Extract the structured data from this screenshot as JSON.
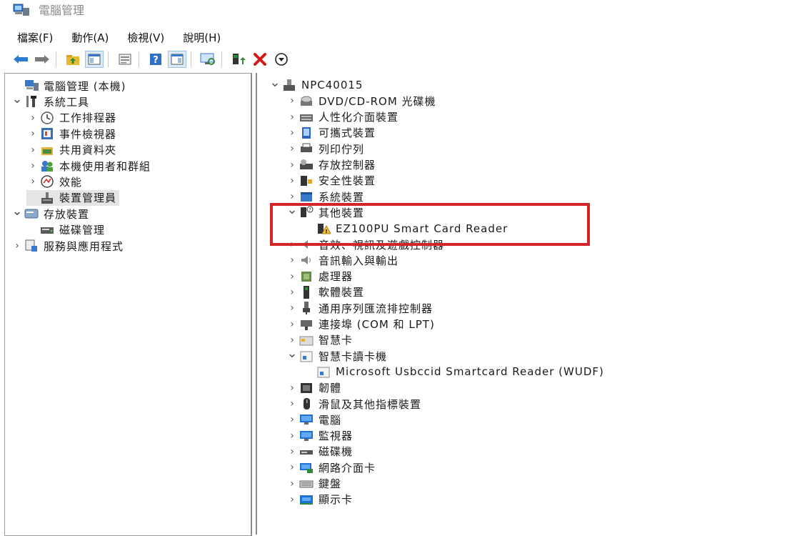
{
  "window": {
    "title": "電腦管理"
  },
  "menubar": {
    "items": [
      "檔案(F)",
      "動作(A)",
      "檢視(V)",
      "說明(H)"
    ]
  },
  "toolbar": {
    "buttons": [
      {
        "icon": "back-arrow-icon"
      },
      {
        "icon": "forward-arrow-icon"
      },
      {
        "icon": "folder-up-icon"
      },
      {
        "icon": "show-hide-tree-icon"
      },
      {
        "icon": "properties-icon"
      },
      {
        "icon": "help-icon"
      },
      {
        "icon": "console-view-icon"
      },
      {
        "icon": "monitor-scan-icon"
      },
      {
        "icon": "update-driver-icon"
      },
      {
        "icon": "uninstall-x-icon"
      },
      {
        "icon": "download-arrow-icon"
      }
    ]
  },
  "left_tree": [
    {
      "label": "電腦管理 (本機)",
      "icon": "computer-management-icon",
      "chev": "",
      "indent": 0
    },
    {
      "label": "系統工具",
      "icon": "system-tools-icon",
      "chev": "expanded",
      "indent": 0
    },
    {
      "label": "工作排程器",
      "icon": "task-scheduler-icon",
      "chev": "collapsed",
      "indent": 1
    },
    {
      "label": "事件檢視器",
      "icon": "event-viewer-icon",
      "chev": "collapsed",
      "indent": 1
    },
    {
      "label": "共用資料夾",
      "icon": "shared-folders-icon",
      "chev": "collapsed",
      "indent": 1
    },
    {
      "label": "本機使用者和群組",
      "icon": "local-users-icon",
      "chev": "collapsed",
      "indent": 1
    },
    {
      "label": "效能",
      "icon": "performance-icon",
      "chev": "collapsed",
      "indent": 1
    },
    {
      "label": "裝置管理員",
      "icon": "device-manager-icon",
      "chev": "",
      "indent": 1,
      "selected": true
    },
    {
      "label": "存放裝置",
      "icon": "storage-icon",
      "chev": "expanded",
      "indent": 0
    },
    {
      "label": "磁碟管理",
      "icon": "disk-management-icon",
      "chev": "",
      "indent": 1
    },
    {
      "label": "服務與應用程式",
      "icon": "services-apps-icon",
      "chev": "collapsed",
      "indent": 0
    }
  ],
  "right_tree": [
    {
      "label": "NPC40015",
      "icon": "computer-root-icon",
      "chev": "expanded",
      "indent": 0
    },
    {
      "label": "DVD/CD-ROM 光碟機",
      "icon": "dvd-drive-icon",
      "chev": "collapsed",
      "indent": 1
    },
    {
      "label": "人性化介面裝置",
      "icon": "hid-icon",
      "chev": "collapsed",
      "indent": 1
    },
    {
      "label": "可攜式裝置",
      "icon": "portable-device-icon",
      "chev": "collapsed",
      "indent": 1
    },
    {
      "label": "列印佇列",
      "icon": "print-queue-icon",
      "chev": "collapsed",
      "indent": 1
    },
    {
      "label": "存放控制器",
      "icon": "storage-controller-icon",
      "chev": "collapsed",
      "indent": 1
    },
    {
      "label": "安全性裝置",
      "icon": "security-device-icon",
      "chev": "collapsed",
      "indent": 1
    },
    {
      "label": "系統裝置",
      "icon": "system-device-icon",
      "chev": "collapsed",
      "indent": 1
    },
    {
      "label": "其他裝置",
      "icon": "other-devices-icon",
      "chev": "expanded",
      "indent": 1
    },
    {
      "label": "EZ100PU Smart Card Reader",
      "icon": "warning-device-icon",
      "chev": "",
      "indent": 2
    },
    {
      "label": "音效、視訊及遊戲控制器",
      "icon": "sound-video-icon",
      "chev": "collapsed",
      "indent": 1
    },
    {
      "label": "音訊輸入與輸出",
      "icon": "audio-io-icon",
      "chev": "collapsed",
      "indent": 1
    },
    {
      "label": "處理器",
      "icon": "processor-icon",
      "chev": "collapsed",
      "indent": 1
    },
    {
      "label": "軟體裝置",
      "icon": "software-device-icon",
      "chev": "collapsed",
      "indent": 1
    },
    {
      "label": "通用序列匯流排控制器",
      "icon": "usb-controller-icon",
      "chev": "collapsed",
      "indent": 1
    },
    {
      "label": "連接埠 (COM 和 LPT)",
      "icon": "ports-icon",
      "chev": "collapsed",
      "indent": 1
    },
    {
      "label": "智慧卡",
      "icon": "smart-card-icon",
      "chev": "collapsed",
      "indent": 1
    },
    {
      "label": "智慧卡讀卡機",
      "icon": "smart-card-reader-icon",
      "chev": "expanded",
      "indent": 1
    },
    {
      "label": "Microsoft Usbccid Smartcard Reader (WUDF)",
      "icon": "smart-card-reader-device-icon",
      "chev": "",
      "indent": 2
    },
    {
      "label": "韌體",
      "icon": "firmware-icon",
      "chev": "collapsed",
      "indent": 1
    },
    {
      "label": "滑鼠及其他指標裝置",
      "icon": "mouse-icon",
      "chev": "collapsed",
      "indent": 1
    },
    {
      "label": "電腦",
      "icon": "computer-icon",
      "chev": "collapsed",
      "indent": 1
    },
    {
      "label": "監視器",
      "icon": "monitor-icon",
      "chev": "collapsed",
      "indent": 1
    },
    {
      "label": "磁碟機",
      "icon": "disk-drive-icon",
      "chev": "collapsed",
      "indent": 1
    },
    {
      "label": "網路介面卡",
      "icon": "network-adapter-icon",
      "chev": "collapsed",
      "indent": 1
    },
    {
      "label": "鍵盤",
      "icon": "keyboard-icon",
      "chev": "collapsed",
      "indent": 1
    },
    {
      "label": "顯示卡",
      "icon": "display-adapter-icon",
      "chev": "collapsed",
      "indent": 1
    }
  ],
  "colors": {
    "highlight": "#d3232b",
    "selection": "#e5e5e5",
    "accent_blue": "#1f7ad6",
    "uninstall_red": "#d11a1a"
  }
}
